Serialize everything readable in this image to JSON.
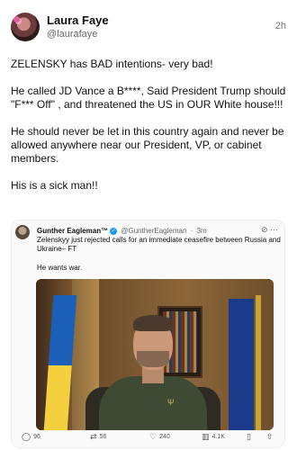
{
  "post": {
    "author_name": "Laura Faye",
    "author_handle": "@laurafaye",
    "timestamp": "2h",
    "paragraphs": [
      "ZELENSKY has BAD intentions- very bad!",
      "He called JD Vance a B****, Said President Trump should \"F*** Off\" , and threatened the US in OUR White house!!!",
      "He should never be let in this country again and never be allowed anywhere near our President, VP, or cabinet members.",
      "His is a sick man!!"
    ]
  },
  "quoted": {
    "author_name": "Gunther Eagleman™",
    "author_handle": "@GuntherEagleman",
    "age": "3m",
    "text": "Zelenskyy just rejected calls for an immediate ceasefire between Russia and Ukraine– FT",
    "text2": "He wants war.",
    "actions": {
      "replies": "96",
      "reposts": "56",
      "likes": "240",
      "views": "4.1K"
    }
  },
  "icons": {
    "verified": "verified-badge-icon",
    "grok": "grok-icon",
    "more": "more-options-icon",
    "reply": "reply-icon",
    "repost": "repost-icon",
    "like": "heart-icon",
    "views": "views-icon",
    "bookmark": "bookmark-icon",
    "share": "share-icon"
  }
}
